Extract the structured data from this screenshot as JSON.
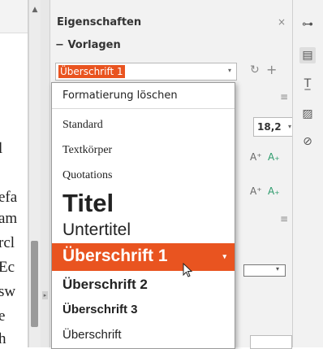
{
  "document": {
    "fragments": [
      "l",
      "efa",
      "am",
      "rcl",
      "Ec",
      "sw",
      "e",
      "h"
    ]
  },
  "panel": {
    "title": "Eigenschaften",
    "close_glyph": "×",
    "section_label": "Vorlagen",
    "section_collapse_glyph": "−",
    "style_select": {
      "value": "Überschrift 1",
      "arrow_glyph": "▾"
    },
    "refresh_glyph": "↻",
    "add_glyph": "+",
    "menu_glyph": "≡",
    "font_size": {
      "value": "18,2",
      "arrow_glyph": "▾"
    },
    "grow_font_glyph": "A⁺",
    "shrink_font_glyph": "A₊",
    "line_arrow_glyph": "▾"
  },
  "tabbar": {
    "icons": [
      "sliders-icon",
      "properties-icon",
      "styles-icon",
      "gallery-icon",
      "navigator-icon"
    ],
    "glyphs": [
      "⊶",
      "▤",
      "T̲",
      "▨",
      "⊘"
    ]
  },
  "dropdown": {
    "items": [
      "Formatierung löschen",
      "Standard",
      "Textkörper",
      "Quotations",
      "Titel",
      "Untertitel",
      "Überschrift 1",
      "Überschrift 2",
      "Überschrift 3",
      "Überschrift"
    ],
    "selected": "Überschrift 1",
    "selected_arrow_glyph": "▾"
  },
  "colors": {
    "accent": "#e95420",
    "panel_bg": "#f2f2f2",
    "dropdown_border": "#9a9a9a"
  }
}
